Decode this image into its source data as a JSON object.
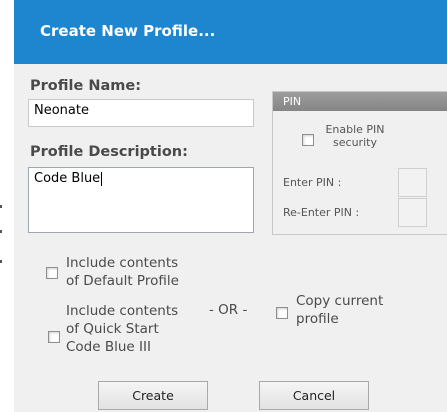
{
  "window": {
    "title": "Create New Profile..."
  },
  "profile_name": {
    "label": "Profile Name:",
    "value": "Neonate"
  },
  "profile_description": {
    "label": "Profile Description:",
    "value": "Code Blue"
  },
  "pin": {
    "header": "PIN",
    "enable_label": "Enable PIN security",
    "enter_label": "Enter PIN :",
    "reenter_label": "Re-Enter PIN :"
  },
  "options": {
    "include_default_line1": "Include contents",
    "include_default_line2": "of Default Profile",
    "include_quick_line1": "Include contents",
    "include_quick_line2": "of Quick Start",
    "include_quick_line3": "Code Blue III",
    "or_label": "- OR -",
    "copy_line1": "Copy current",
    "copy_line2": "profile"
  },
  "buttons": {
    "create": "Create",
    "cancel": "Cancel"
  },
  "colors": {
    "titlebar": "#1e86cf",
    "dialog_bg": "#f0f0f0"
  }
}
